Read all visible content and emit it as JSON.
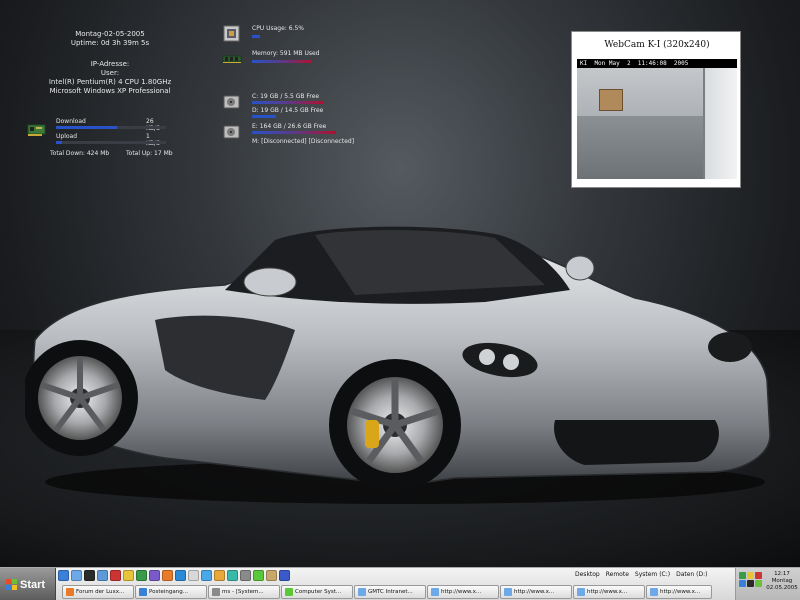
{
  "sysinfo": {
    "date": "Montag-02-05-2005",
    "uptime": "Uptime: 0d 3h 39m 5s",
    "ip_label": "IP-Adresse:",
    "user_label": "User:",
    "cpu": "Intel(R) Pentium(R) 4 CPU 1.80GHz",
    "os": "Microsoft Windows XP Professional"
  },
  "network": {
    "download_label": "Download",
    "download_value": "26 KB/S",
    "download_level": 0.55,
    "upload_label": "Upload",
    "upload_value": "1 KB/S",
    "upload_level": 0.05,
    "total_down": "Total Down: 424 Mb",
    "total_up": "Total Up: 17 Mb",
    "icon": "network-card-icon"
  },
  "usage": {
    "cpu_label": "CPU Usage: 6.5%",
    "cpu_level": 0.065,
    "memory_label": "Memory: 591 MB Used",
    "memory_level": 0.6,
    "drive_c_label": "C: 19 GB / 5.5 GB Free",
    "drive_c_level": 0.71,
    "drive_d_label": "D: 19 GB / 14.5 GB Free",
    "drive_d_level": 0.24,
    "drive_e_label": "E: 164 GB / 26.6 GB Free",
    "drive_e_level": 0.84,
    "drive_m_label": "M: [Disconnected] [Disconnected]"
  },
  "webcam": {
    "title": "WebCam K-I (320x240)",
    "timestamp": "KI  Mon May  2  11:46:08  2005"
  },
  "taskbar": {
    "start_label": "Start",
    "toolbars": [
      "Desktop",
      "Remote",
      "System (C:)",
      "Daten (D:)"
    ],
    "tasks": [
      {
        "label": "Forum der Luxx..."
      },
      {
        "label": "Posteingang..."
      },
      {
        "label": "ms - [System..."
      },
      {
        "label": "Computer Syst..."
      },
      {
        "label": "GMTC Intranet..."
      },
      {
        "label": "http://www.x..."
      },
      {
        "label": "http://www.x..."
      },
      {
        "label": "http://www.x..."
      },
      {
        "label": "http://www.x..."
      }
    ],
    "clock_time": "12:17",
    "clock_day": "Montag",
    "clock_date": "02.05.2005"
  },
  "colors": {
    "bar_blue": "#2a52c8",
    "bar_red": "#b01030",
    "taskbar": "#e6e6e6"
  }
}
